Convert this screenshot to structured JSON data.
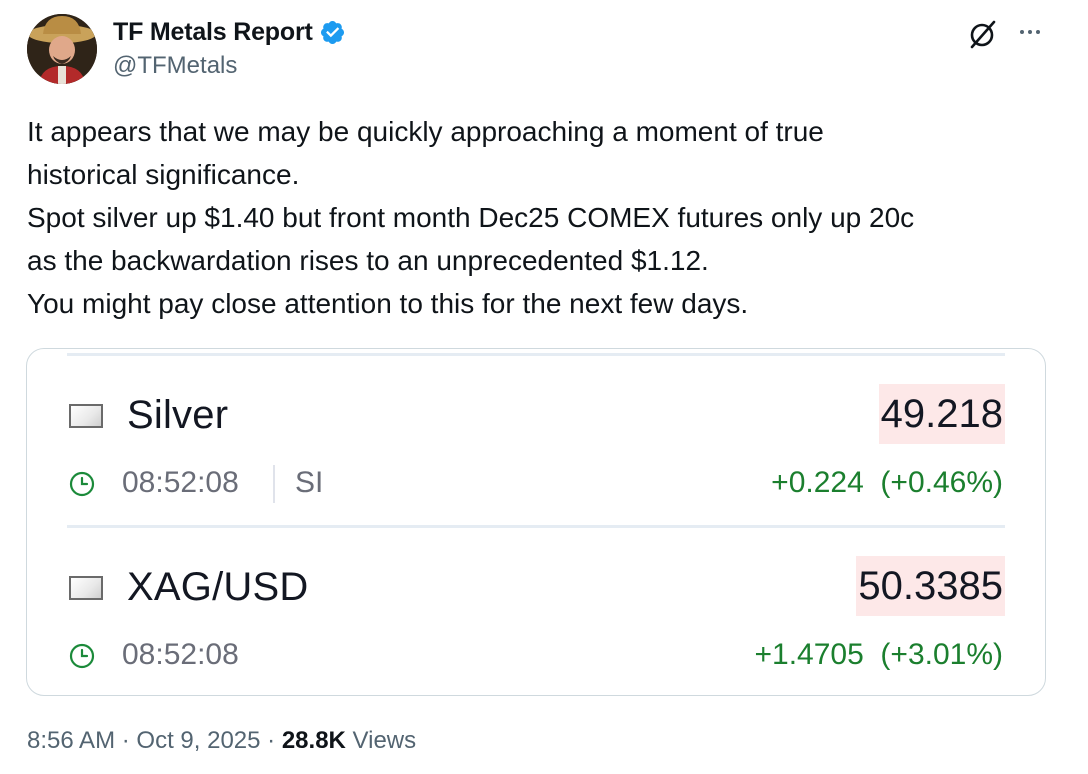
{
  "tweet": {
    "display_name": "TF Metals Report",
    "handle": "@TFMetals",
    "verified": true,
    "text_lines": [
      "It appears that we may be quickly approaching a moment of true",
      "historical significance.",
      "Spot silver up $1.40 but front month Dec25 COMEX futures only up 20c",
      "as the backwardation rises to an unprecedented $1.12.",
      "You might pay close attention to this for the next few days."
    ],
    "time": "8:56 AM",
    "date": "Oct 9, 2025",
    "views_count": "28.8K",
    "views_label": "Views"
  },
  "quotes": [
    {
      "symbol_name": "Silver",
      "price": "49.218",
      "time": "08:52:08",
      "exchange": "SI",
      "change": "+0.224  (+0.46%)"
    },
    {
      "symbol_name": "XAG/USD",
      "price": "50.3385",
      "time": "08:52:08",
      "exchange": "",
      "change": "+1.4705  (+3.01%)"
    }
  ],
  "colors": {
    "verified_blue": "#1d9bf0",
    "positive_green": "#1b7f2e",
    "price_highlight": "#fde8e8",
    "secondary_text": "#536471"
  },
  "icons": [
    "verified-badge-icon",
    "grok-icon",
    "more-options-icon",
    "flag-icon",
    "clock-icon"
  ]
}
